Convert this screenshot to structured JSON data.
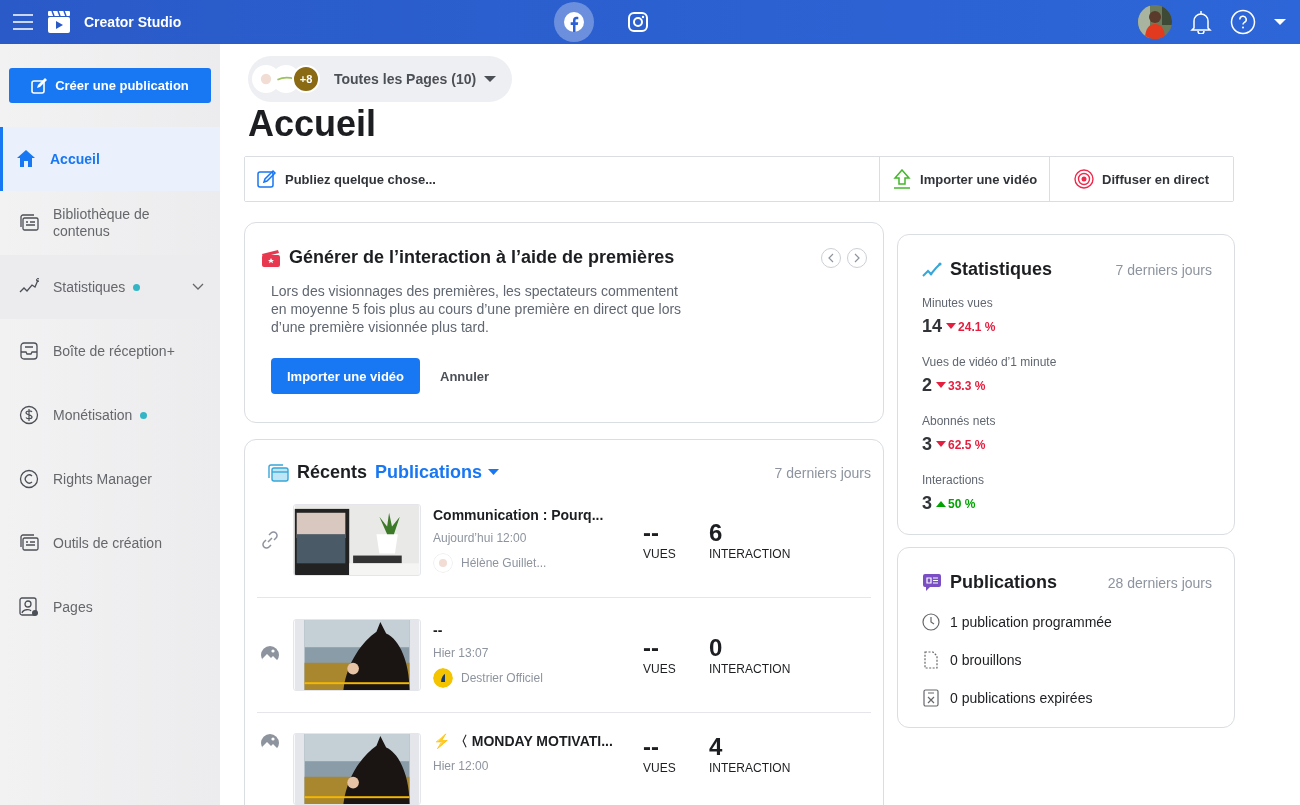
{
  "topbar": {
    "title": "Creator Studio",
    "platforms": [
      {
        "kind": "facebook",
        "selected": true
      },
      {
        "kind": "instagram",
        "selected": false
      }
    ]
  },
  "sidebar": {
    "create_button": "Créer une publication",
    "items": [
      {
        "label": "Accueil",
        "selected": true
      },
      {
        "label": "Bibliothèque de contenus",
        "selected": false
      },
      {
        "label": "Statistiques",
        "selected": false,
        "dot": true,
        "expanded": false
      },
      {
        "label": "Boîte de réception+",
        "selected": false
      },
      {
        "label": "Monétisation",
        "selected": false,
        "dot": true
      },
      {
        "label": "Rights Manager",
        "selected": false
      },
      {
        "label": "Outils de création",
        "selected": false
      },
      {
        "label": "Pages",
        "selected": false
      }
    ]
  },
  "page_selector": {
    "more_count": "+8",
    "label": "Toutes les Pages (10)"
  },
  "heading": "Accueil",
  "actions": [
    {
      "kind": "compose",
      "label": "Publiez quelque chose..."
    },
    {
      "kind": "upload",
      "label": "Importer une vidéo"
    },
    {
      "kind": "live",
      "label": "Diffuser en direct"
    }
  ],
  "premiere_card": {
    "title": "Générer de l’interaction à l’aide de premières",
    "body": "Lors des visionnages des premières, les spectateurs commentent en moyenne 5 fois plus au cours d’une première en direct que lors d’une première visionnée plus tard.",
    "primary_button": "Importer une vidéo",
    "cancel_button": "Annuler"
  },
  "recent": {
    "title": "Récents",
    "filter": "Publications",
    "period": "7 derniers jours",
    "posts": [
      {
        "kind": "link",
        "title": "Communication : Pourq...",
        "time": "Aujourd’hui 12:00",
        "page": "Hélène Guillet...",
        "views": "--",
        "views_label": "VUES",
        "interactions": "6",
        "interactions_label": "INTERACTION"
      },
      {
        "title": "--",
        "time": "Hier 13:07",
        "page": "Destrier Officiel",
        "views": "--",
        "views_label": "VUES",
        "interactions": "0",
        "interactions_label": "INTERACTION"
      },
      {
        "title": "⚡ 〈 MONDAY MOTIVATI...",
        "time": "Hier 12:00",
        "views": "--",
        "views_label": "VUES",
        "interactions": "4",
        "interactions_label": "INTERACTION"
      }
    ]
  },
  "stats": {
    "title": "Statistiques",
    "period": "7 derniers jours",
    "items": [
      {
        "label": "Minutes vues",
        "value": "14",
        "change": "24.1 %",
        "rising": false
      },
      {
        "label": "Vues de vidéo d’1 minute",
        "value": "2",
        "change": "33.3 %",
        "rising": false
      },
      {
        "label": "Abonnés nets",
        "value": "3",
        "change": "62.5 %",
        "rising": false
      },
      {
        "label": "Interactions",
        "value": "3",
        "change": "50 %",
        "rising": true
      }
    ]
  },
  "publications": {
    "title": "Publications",
    "period": "28 derniers jours",
    "items": [
      {
        "kind": "scheduled",
        "label": "1 publication programmée"
      },
      {
        "kind": "draft",
        "label": "0 brouillons"
      },
      {
        "kind": "expired",
        "label": "0 publications expirées"
      }
    ]
  }
}
